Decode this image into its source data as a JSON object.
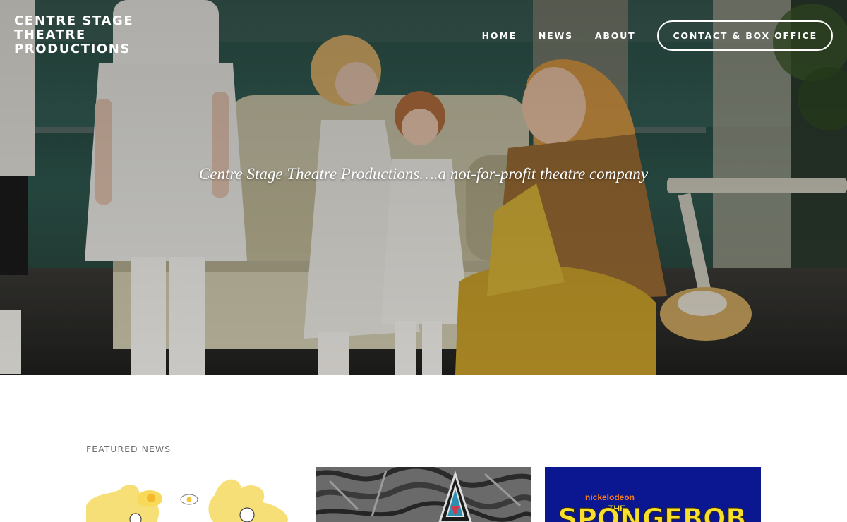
{
  "header": {
    "site_title_lines": [
      "CENTRE STAGE",
      "THEATRE",
      "PRODUCTIONS"
    ],
    "nav": [
      {
        "label": "HOME"
      },
      {
        "label": "NEWS"
      },
      {
        "label": "ABOUT"
      },
      {
        "label": "CONTACT & BOX OFFICE"
      }
    ]
  },
  "hero": {
    "tagline": "Centre Stage Theatre Productions….a not-for-profit theatre company"
  },
  "featured": {
    "heading": "FEATURED NEWS",
    "cards": [
      {
        "image": "yellow-splash-cartoon-image"
      },
      {
        "image": "graffiti-pyramid-image"
      },
      {
        "image": "spongebob-musical-logo-image",
        "brand": "nickelodeon",
        "text_top": "THE",
        "text_main": "SPONGEBOB"
      }
    ]
  },
  "colors": {
    "hero_text": "#ffffff",
    "featured_heading": "#6d6d6d",
    "spongebob_bg": "#0a1791",
    "spongebob_yellow": "#f7e02d",
    "nickelodeon_orange": "#f47c20"
  }
}
